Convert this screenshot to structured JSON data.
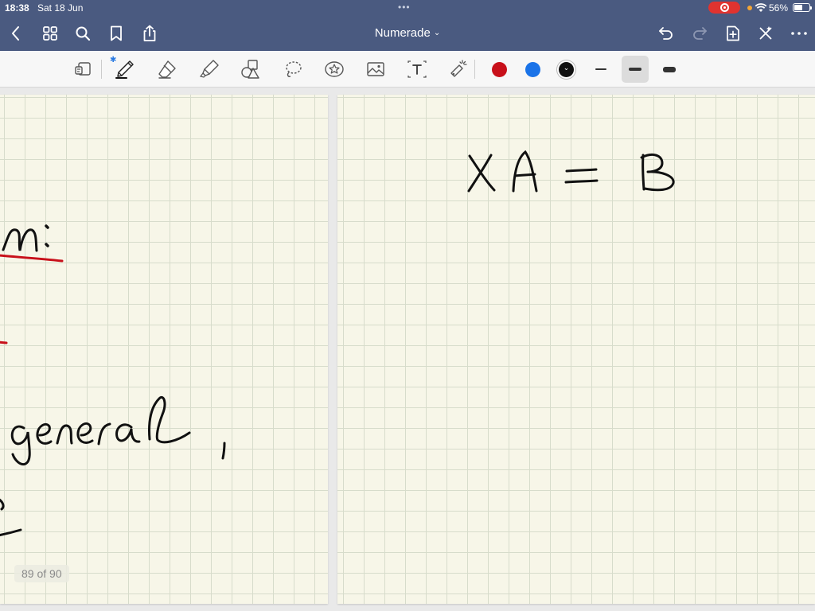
{
  "status_bar": {
    "time": "18:38",
    "date": "Sat 18 Jun",
    "battery_percent": "56%",
    "battery_level": 0.56
  },
  "nav_bar": {
    "title": "Numerade",
    "left_icons": [
      "back-chevron-icon",
      "grid-view-icon",
      "search-icon",
      "bookmark-icon",
      "share-icon"
    ],
    "right_icons": [
      "undo-icon",
      "redo-icon",
      "add-page-icon",
      "close-icon",
      "more-icon"
    ]
  },
  "toolbar": {
    "tools": [
      "lasso-read-icon",
      "pen-icon",
      "eraser-icon",
      "highlighter-icon",
      "shapes-icon",
      "lasso-icon",
      "sticker-icon",
      "image-icon",
      "text-icon",
      "laser-pointer-icon"
    ],
    "selected_tool": "pen-icon",
    "colors": [
      {
        "name": "red",
        "hex": "#c8101a"
      },
      {
        "name": "blue",
        "hex": "#1a73e8"
      },
      {
        "name": "black",
        "hex": "#111111"
      }
    ],
    "selected_color": "black",
    "stroke_widths": [
      "thin",
      "medium",
      "thick"
    ],
    "selected_stroke": "medium"
  },
  "document": {
    "page_counter": "89 of 90",
    "left_page_handwriting": [
      "n :",
      "general ,"
    ],
    "right_page_handwriting": "X A = B",
    "ink_colors": {
      "red": "#c8101a",
      "black": "#111111"
    }
  }
}
